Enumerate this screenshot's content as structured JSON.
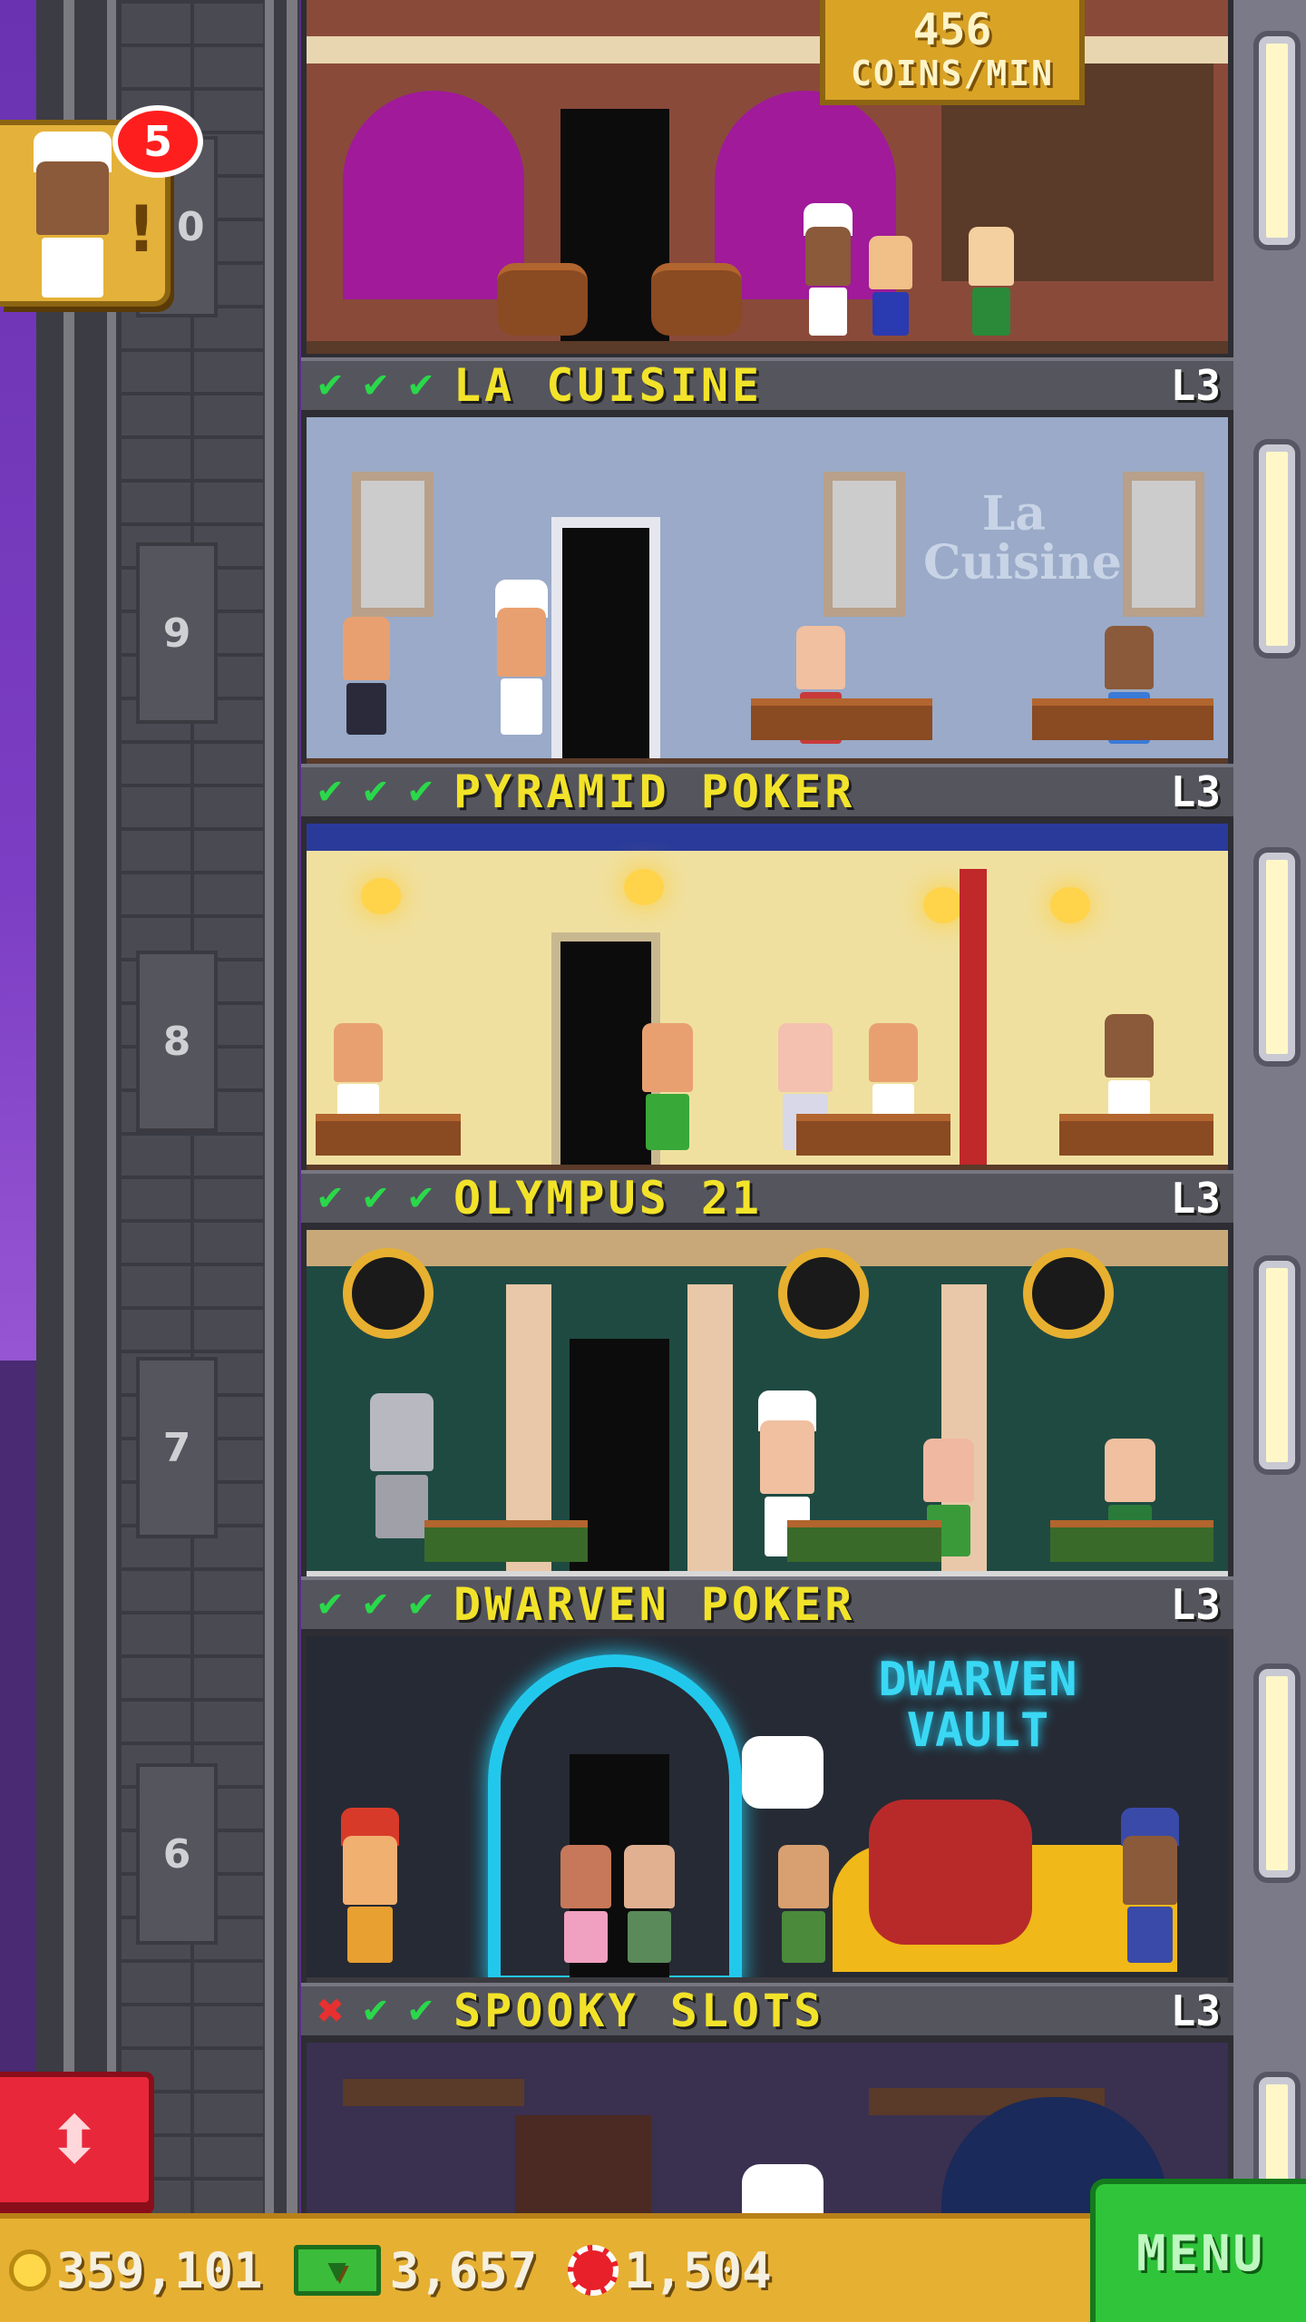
{
  "coins_per_min": {
    "value": "456",
    "unit": "COINS/MIN"
  },
  "visitor_popup": {
    "badge_count": "5",
    "icon": "chef-visitor-icon"
  },
  "floors": [
    {
      "number": "10",
      "name": "LA CUISINE",
      "level": "L3",
      "stars": [
        "check",
        "check",
        "check"
      ],
      "theme": "restaurant-wine-cellar"
    },
    {
      "number": "9",
      "name": "PYRAMID POKER",
      "level": "L3",
      "stars": [
        "check",
        "check",
        "check"
      ],
      "theme": "la-cuisine-dining"
    },
    {
      "number": "8",
      "name": "OLYMPUS 21",
      "level": "L3",
      "stars": [
        "check",
        "check",
        "check"
      ],
      "theme": "egyptian-poker"
    },
    {
      "number": "7",
      "name": "DWARVEN POKER",
      "level": "L3",
      "stars": [
        "check",
        "check",
        "check"
      ],
      "theme": "olympus-casino"
    },
    {
      "number": "6",
      "name": "SPOOKY SLOTS",
      "level": "L3",
      "stars": [
        "cross",
        "check",
        "check"
      ],
      "theme": "dwarven-vault"
    }
  ],
  "room_signs": {
    "la_cuisine": "La Cuisine",
    "dwarven_vault": "DWARVEN VAULT"
  },
  "hud": {
    "coins": "359,101",
    "bux": "3,657",
    "chips": "1,504",
    "menu_label": "MENU"
  },
  "colors": {
    "banner_text": "#f2e32a",
    "check": "#2ad84a",
    "cross": "#e83030",
    "menu": "#2fc43a"
  }
}
